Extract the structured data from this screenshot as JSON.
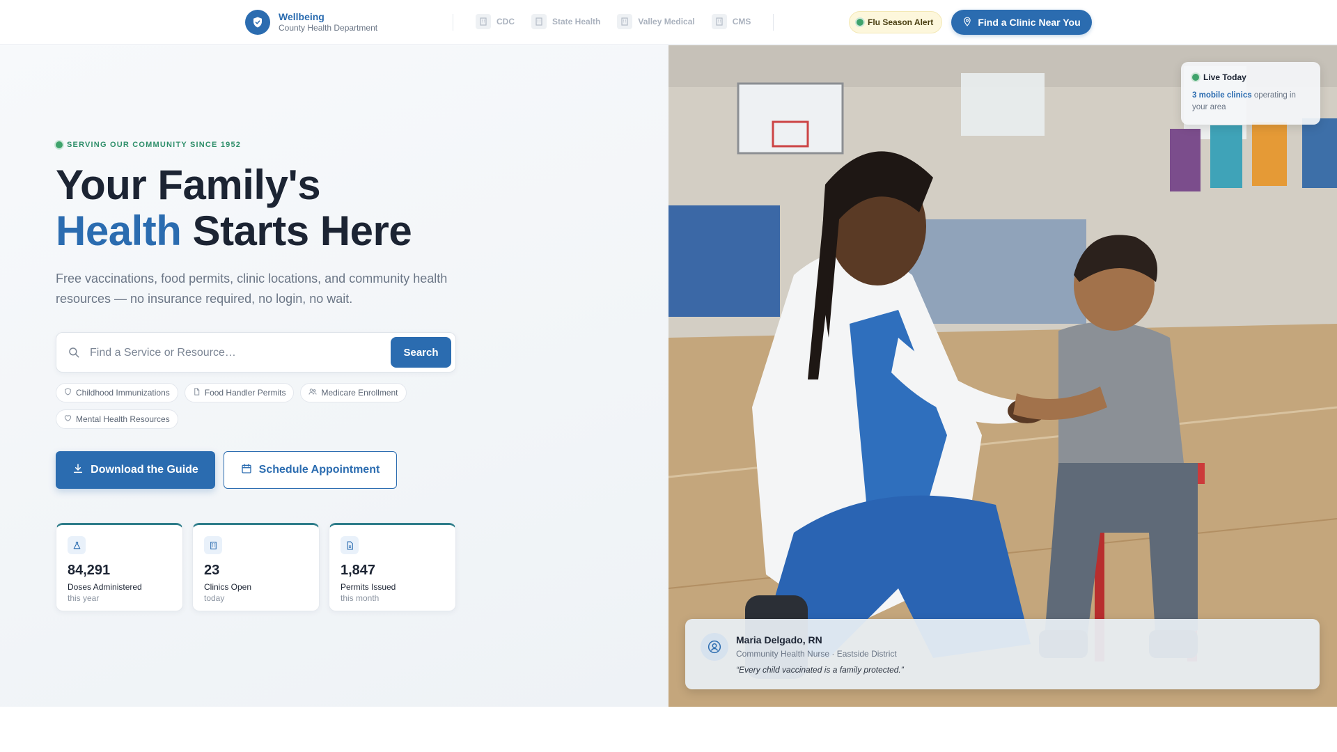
{
  "header": {
    "brand_name": "Wellbeing",
    "brand_subtitle": "County Health Department",
    "partners": [
      "CDC",
      "State Health",
      "Valley Medical",
      "CMS"
    ],
    "alert_label": "Flu Season Alert",
    "cta_label": "Find a Clinic Near You"
  },
  "hero": {
    "eyebrow": "SERVING OUR COMMUNITY SINCE 1952",
    "headline_line1": "Your Family's",
    "headline_accent": "Health",
    "headline_rest": " Starts Here",
    "lead": "Free vaccinations, food permits, clinic locations, and community health resources — no insurance required, no login, no wait."
  },
  "search": {
    "placeholder": "Find a Service or Resource…",
    "button_label": "Search"
  },
  "quick_links": [
    {
      "label": "Childhood Immunizations",
      "icon": "shield-icon"
    },
    {
      "label": "Food Handler Permits",
      "icon": "document-icon"
    },
    {
      "label": "Medicare Enrollment",
      "icon": "people-icon"
    },
    {
      "label": "Mental Health Resources",
      "icon": "heart-icon"
    }
  ],
  "actions": {
    "primary_label": "Download the Guide",
    "secondary_label": "Schedule Appointment"
  },
  "stats": [
    {
      "value": "84,291",
      "label": "Doses Administered",
      "sub": "this year",
      "icon": "flask-icon"
    },
    {
      "value": "23",
      "label": "Clinics Open",
      "sub": "today",
      "icon": "building-icon"
    },
    {
      "value": "1,847",
      "label": "Permits Issued",
      "sub": "this month",
      "icon": "document-icon"
    }
  ],
  "live": {
    "title": "Live Today",
    "highlight": "3 mobile clinics",
    "text": " operating in your area"
  },
  "testimonial": {
    "name": "Maria Delgado, RN",
    "role": "Community Health Nurse · Eastside District",
    "quote": "“Every child vaccinated is a family protected.”"
  },
  "colors": {
    "brand": "#2b6cb0",
    "accent_green": "#3fa36c",
    "stat_border": "#2e7d8a"
  }
}
